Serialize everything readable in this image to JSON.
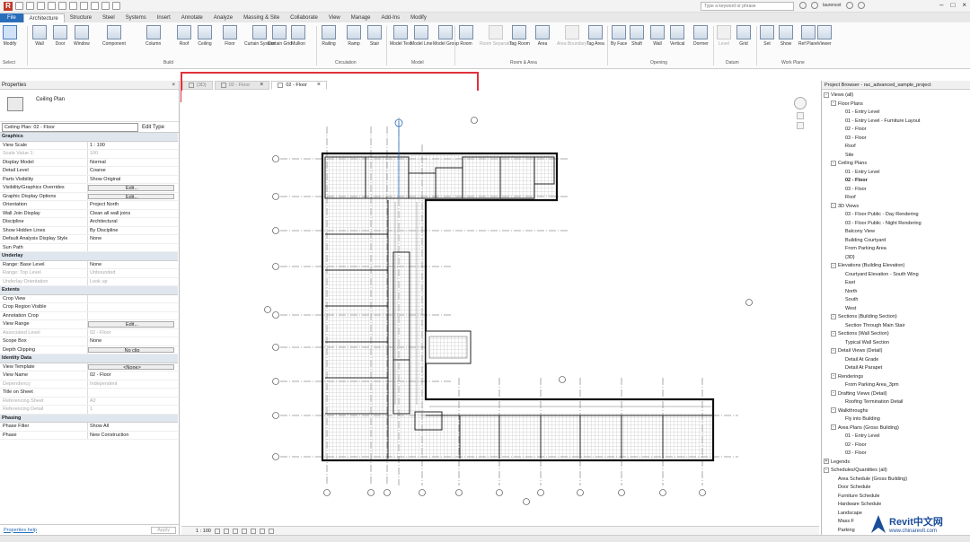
{
  "search": {
    "placeholder": "Type a keyword or phrase"
  },
  "user": "laurencet",
  "ribbon_tabs": [
    "File",
    "Architecture",
    "Structure",
    "Steel",
    "Systems",
    "Insert",
    "Annotate",
    "Analyze",
    "Massing & Site",
    "Collaborate",
    "View",
    "Manage",
    "Add-Ins",
    "Modify"
  ],
  "ribbon": {
    "buttons": [
      "Modify",
      "Wall",
      "Door",
      "Window",
      "Component",
      "Column",
      "Roof",
      "Ceiling",
      "Floor",
      "Curtain System",
      "Curtain Grid",
      "Mullion",
      "Railing",
      "Ramp",
      "Stair",
      "Model Text",
      "Model Line",
      "Model Group",
      "Room",
      "Room Separator",
      "Tag Room",
      "Area",
      "Area Boundary",
      "Tag Area",
      "By Face",
      "Shaft",
      "Wall",
      "Vertical",
      "Dormer",
      "Level",
      "Grid",
      "Set",
      "Show",
      "Ref Plane",
      "Viewer"
    ],
    "groups": [
      "Select",
      "Build",
      "Circulation",
      "Model",
      "Room & Area",
      "Opening",
      "Datum",
      "Work Plane"
    ]
  },
  "properties": {
    "header": "Properties",
    "type_name": "Ceiling Plan",
    "selector": "Ceiling Plan: 02 - Floor",
    "edit_type": "Edit Type",
    "groups": [
      {
        "name": "Graphics",
        "rows": [
          [
            "View Scale",
            "1 : 100"
          ],
          [
            "Scale Value    1:",
            "100"
          ],
          [
            "Display Model",
            "Normal"
          ],
          [
            "Detail Level",
            "Coarse"
          ],
          [
            "Parts Visibility",
            "Show Original"
          ],
          [
            "Visibility/Graphics Overrides",
            "Edit..."
          ],
          [
            "Graphic Display Options",
            "Edit..."
          ],
          [
            "Orientation",
            "Project North"
          ],
          [
            "Wall Join Display",
            "Clean all wall joins"
          ],
          [
            "Discipline",
            "Architectural"
          ],
          [
            "Show Hidden Lines",
            "By Discipline"
          ],
          [
            "Default Analysis Display Style",
            "None"
          ],
          [
            "Sun Path",
            ""
          ]
        ]
      },
      {
        "name": "Underlay",
        "rows": [
          [
            "Range: Base Level",
            "None"
          ],
          [
            "Range: Top Level",
            "Unbounded"
          ],
          [
            "Underlay Orientation",
            "Look up"
          ]
        ]
      },
      {
        "name": "Extents",
        "rows": [
          [
            "Crop View",
            ""
          ],
          [
            "Crop Region Visible",
            ""
          ],
          [
            "Annotation Crop",
            ""
          ],
          [
            "View Range",
            "Edit..."
          ],
          [
            "Associated Level",
            "02 - Floor"
          ],
          [
            "Scope Box",
            "None"
          ],
          [
            "Depth Clipping",
            "No clip"
          ]
        ]
      },
      {
        "name": "Identity Data",
        "rows": [
          [
            "View Template",
            "<None>"
          ],
          [
            "View Name",
            "02 - Floor"
          ],
          [
            "Dependency",
            "Independent"
          ],
          [
            "Title on Sheet",
            ""
          ],
          [
            "Referencing Sheet",
            "A2"
          ],
          [
            "Referencing Detail",
            "1"
          ]
        ]
      },
      {
        "name": "Phasing",
        "rows": [
          [
            "Phase Filter",
            "Show All"
          ],
          [
            "Phase",
            "New Construction"
          ]
        ]
      }
    ],
    "help_link": "Properties help",
    "apply": "Apply"
  },
  "view_tabs": [
    {
      "label": "{3D}",
      "active": false
    },
    {
      "label": "02 - Floor",
      "active": false
    },
    {
      "label": "02 - Floor",
      "active": true
    }
  ],
  "view_control": {
    "scale": "1 : 100"
  },
  "project_browser": {
    "header": "Project Browser - rac_advanced_sample_project",
    "items": [
      {
        "t": "Views (all)",
        "l": 0,
        "g": "-"
      },
      {
        "t": "Floor Plans",
        "l": 1,
        "g": "-"
      },
      {
        "t": "01 - Entry Level",
        "l": 2
      },
      {
        "t": "01 - Entry Level - Furniture Layout",
        "l": 2
      },
      {
        "t": "02 - Floor",
        "l": 2
      },
      {
        "t": "03 - Floor",
        "l": 2
      },
      {
        "t": "Roof",
        "l": 2
      },
      {
        "t": "Site",
        "l": 2
      },
      {
        "t": "Ceiling Plans",
        "l": 1,
        "g": "-"
      },
      {
        "t": "01 - Entry Level",
        "l": 2
      },
      {
        "t": "02 - Floor",
        "l": 2,
        "sel": true
      },
      {
        "t": "03 - Floor",
        "l": 2
      },
      {
        "t": "Roof",
        "l": 2
      },
      {
        "t": "3D Views",
        "l": 1,
        "g": "-"
      },
      {
        "t": "03 - Floor Public - Day Rendering",
        "l": 2
      },
      {
        "t": "03 - Floor Public - Night Rendering",
        "l": 2
      },
      {
        "t": "Balcony View",
        "l": 2
      },
      {
        "t": "Building Courtyard",
        "l": 2
      },
      {
        "t": "From Parking Area",
        "l": 2
      },
      {
        "t": "{3D}",
        "l": 2
      },
      {
        "t": "Elevations (Building Elevation)",
        "l": 1,
        "g": "-"
      },
      {
        "t": "Courtyard Elevation - South Wing",
        "l": 2
      },
      {
        "t": "East",
        "l": 2
      },
      {
        "t": "North",
        "l": 2
      },
      {
        "t": "South",
        "l": 2
      },
      {
        "t": "West",
        "l": 2
      },
      {
        "t": "Sections (Building Section)",
        "l": 1,
        "g": "-"
      },
      {
        "t": "Section Through Main Stair",
        "l": 2
      },
      {
        "t": "Sections (Wall Section)",
        "l": 1,
        "g": "-"
      },
      {
        "t": "Typical Wall Section",
        "l": 2
      },
      {
        "t": "Detail Views (Detail)",
        "l": 1,
        "g": "-"
      },
      {
        "t": "Detail At Grade",
        "l": 2
      },
      {
        "t": "Detail At Parapet",
        "l": 2
      },
      {
        "t": "Renderings",
        "l": 1,
        "g": "-"
      },
      {
        "t": "From Parking Area_3pm",
        "l": 2
      },
      {
        "t": "Drafting Views (Detail)",
        "l": 1,
        "g": "-"
      },
      {
        "t": "Roofing Termination Detail",
        "l": 2
      },
      {
        "t": "Walkthroughs",
        "l": 1,
        "g": "-"
      },
      {
        "t": "Fly into Building",
        "l": 2
      },
      {
        "t": "Area Plans (Gross Building)",
        "l": 1,
        "g": "-"
      },
      {
        "t": "01 - Entry Level",
        "l": 2
      },
      {
        "t": "02 - Floor",
        "l": 2
      },
      {
        "t": "03 - Floor",
        "l": 2
      },
      {
        "t": "Legends",
        "l": 0,
        "g": "+"
      },
      {
        "t": "Schedules/Quantities (all)",
        "l": 0,
        "g": "-"
      },
      {
        "t": "Area Schedule (Gross Building)",
        "l": 1
      },
      {
        "t": "Door Schedule",
        "l": 1
      },
      {
        "t": "Furniture Schedule",
        "l": 1
      },
      {
        "t": "Hardware Schedule",
        "l": 1
      },
      {
        "t": "Landscape",
        "l": 1
      },
      {
        "t": "Mass F",
        "l": 1
      },
      {
        "t": "Parking",
        "l": 1
      }
    ]
  },
  "watermark": {
    "title": "Revit中文网",
    "url": "www.chinarevit.com"
  },
  "colors": {
    "accent": "#2a6ebb",
    "highlight_box": "#e0303a"
  }
}
